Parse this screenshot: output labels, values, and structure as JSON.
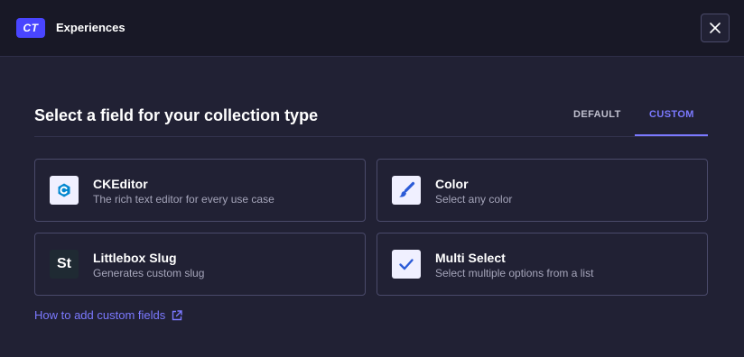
{
  "header": {
    "badge": "CT",
    "title": "Experiences",
    "close_icon": "close-icon"
  },
  "section": {
    "title": "Select a field for your collection type"
  },
  "tabs": [
    {
      "label": "DEFAULT",
      "active": false
    },
    {
      "label": "CUSTOM",
      "active": true
    }
  ],
  "fields": [
    {
      "name": "CKEditor",
      "description": "The rich text editor for every use case",
      "icon": "ckeditor-icon"
    },
    {
      "name": "Color",
      "description": "Select any color",
      "icon": "paintbrush-icon"
    },
    {
      "name": "Littlebox Slug",
      "description": "Generates custom slug",
      "icon": "st-logo-icon",
      "icon_text": "St"
    },
    {
      "name": "Multi Select",
      "description": "Select multiple options from a list",
      "icon": "checkmark-icon"
    }
  ],
  "help_link": {
    "label": "How to add custom fields",
    "icon": "external-link-icon"
  },
  "colors": {
    "accent": "#7b79ff",
    "badge": "#4945ff",
    "background": "#212134",
    "header": "#181826"
  }
}
